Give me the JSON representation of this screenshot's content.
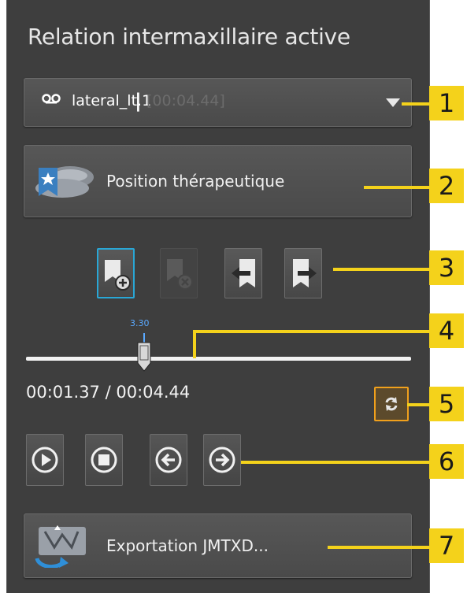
{
  "panel": {
    "title": "Relation intermaxillaire active"
  },
  "recording_dropdown": {
    "icon": "tape-icon",
    "name": "lateral_lt.1",
    "separator": "|",
    "duration": "[00:04.44]"
  },
  "therapeutic_button": {
    "label": "Position thérapeutique",
    "icon": "jaw-bookmark-icon"
  },
  "bookmark_tools": [
    {
      "name": "add-bookmark-button",
      "icon": "bookmark-add-icon",
      "state": "active"
    },
    {
      "name": "remove-bookmark-button",
      "icon": "bookmark-remove-icon",
      "state": "disabled"
    },
    {
      "name": "previous-bookmark-button",
      "icon": "bookmark-previous-icon",
      "state": "normal"
    },
    {
      "name": "next-bookmark-button",
      "icon": "bookmark-next-icon",
      "state": "normal"
    }
  ],
  "slider": {
    "value_label": "3.30",
    "position_fraction": 0.31
  },
  "timecode": "00:01.37 / 00:04.44",
  "loop_toggle": {
    "icon": "loop-icon",
    "active": true,
    "accent": "#f0a01c"
  },
  "playback": [
    {
      "name": "play-button",
      "icon": "play-icon"
    },
    {
      "name": "stop-button",
      "icon": "stop-icon"
    },
    {
      "name": "step-back-button",
      "icon": "arrow-left-icon"
    },
    {
      "name": "step-forward-button",
      "icon": "arrow-right-icon"
    }
  ],
  "export_button": {
    "label": "Exportation JMTXD...",
    "icon": "export-jaw-icon"
  },
  "callouts": [
    "1",
    "2",
    "3",
    "4",
    "5",
    "6",
    "7"
  ],
  "colors": {
    "panel_bg": "#3e3e3e",
    "callout": "#f4d21b",
    "active_border": "#29a7d6",
    "slider_label": "#5aa9ff"
  }
}
